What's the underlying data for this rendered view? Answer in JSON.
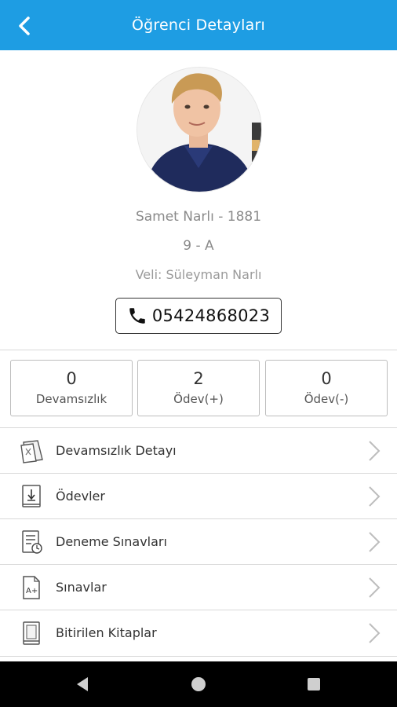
{
  "header": {
    "title": "Öğrenci Detayları"
  },
  "student": {
    "name": "Samet Narlı - 1881",
    "class": "9 - A",
    "parent": "Veli: Süleyman Narlı",
    "phone": "05424868023"
  },
  "stats": [
    {
      "value": "0",
      "label": "Devamsızlık"
    },
    {
      "value": "2",
      "label": "Ödev(+)"
    },
    {
      "value": "0",
      "label": "Ödev(-)"
    }
  ],
  "menu": [
    {
      "label": "Devamsızlık Detayı",
      "icon": "attendance-icon"
    },
    {
      "label": "Ödevler",
      "icon": "homework-icon"
    },
    {
      "label": "Deneme Sınavları",
      "icon": "practice-exam-icon"
    },
    {
      "label": "Sınavlar",
      "icon": "exam-grade-icon"
    },
    {
      "label": "Bitirilen Kitaplar",
      "icon": "book-icon"
    }
  ],
  "colors": {
    "header": "#1e9de3",
    "navbar": "#000000"
  }
}
